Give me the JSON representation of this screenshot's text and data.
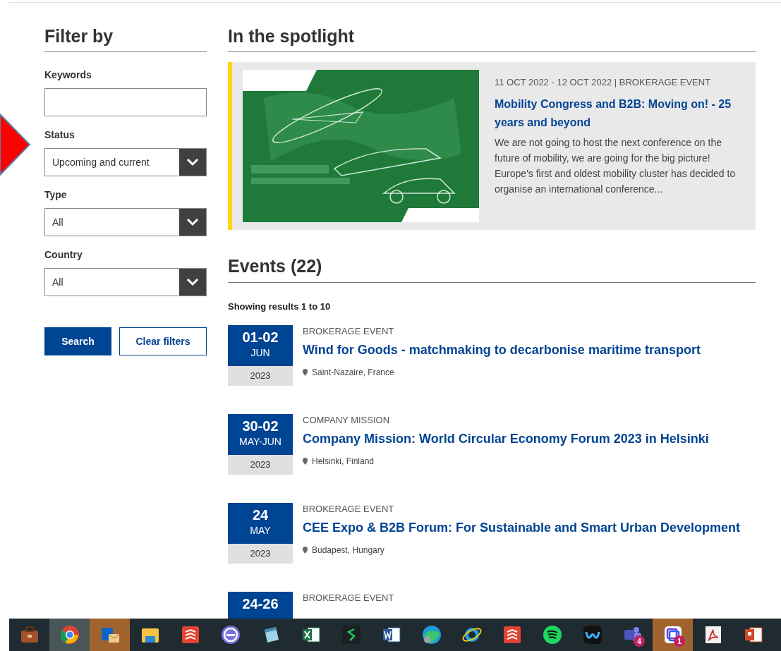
{
  "filters": {
    "title": "Filter by",
    "keywords": {
      "label": "Keywords"
    },
    "selects": [
      {
        "label": "Status",
        "value": "Upcoming and current"
      },
      {
        "label": "Type",
        "value": "All"
      },
      {
        "label": "Country",
        "value": "All"
      }
    ],
    "buttons": [
      {
        "label": "Search",
        "kind": "primary"
      },
      {
        "label": "Clear filters",
        "kind": "secondary"
      }
    ]
  },
  "spotlight": {
    "title": "In the spotlight",
    "meta": "11 OCT 2022 - 12 OCT 2022 | BROKERAGE EVENT",
    "headline": "Mobility Congress and B2B: Moving on! - 25 years and beyond",
    "summary": "We are not going to host the next conference on the future of mobility, we are going for the big picture! Europe's first and oldest mobility cluster has decided to organise an international conference..."
  },
  "events": {
    "title": "Events (22)",
    "results": "Showing results 1 to 10",
    "items": [
      {
        "day": "01-02",
        "month": "JUN",
        "year": "2023",
        "type": "BROKERAGE EVENT",
        "title": "Wind for Goods - matchmaking to decarbonise maritime transport",
        "location": "Saint-Nazaire, France"
      },
      {
        "day": "30-02",
        "month": "MAY-JUN",
        "year": "2023",
        "type": "COMPANY MISSION",
        "title": "Company Mission: World Circular Economy Forum 2023 in Helsinki",
        "location": "Helsinki, Finland"
      },
      {
        "day": "24",
        "month": "MAY",
        "year": "2023",
        "type": "BROKERAGE EVENT",
        "title": "CEE Expo & B2B Forum: For Sustainable and Smart Urban Development",
        "location": "Budapest, Hungary"
      },
      {
        "day": "24-26",
        "type": "BROKERAGE EVENT"
      }
    ]
  },
  "taskbar": {
    "apps": [
      {
        "kind": "briefcase",
        "active": false,
        "flashing": false
      },
      {
        "kind": "chrome",
        "active": true,
        "flashing": false
      },
      {
        "kind": "outlook",
        "active": false,
        "flashing": true
      },
      {
        "kind": "folder",
        "active": false,
        "flashing": false
      },
      {
        "kind": "todo",
        "active": false,
        "flashing": false
      },
      {
        "kind": "ring",
        "active": false,
        "flashing": false
      },
      {
        "kind": "notepad",
        "active": false,
        "flashing": false
      },
      {
        "kind": "excel",
        "active": false,
        "flashing": false
      },
      {
        "kind": "snake",
        "active": false,
        "flashing": false
      },
      {
        "kind": "word",
        "active": false,
        "flashing": false
      },
      {
        "kind": "edge",
        "active": false,
        "flashing": false
      },
      {
        "kind": "ie",
        "active": false,
        "flashing": false
      },
      {
        "kind": "todo",
        "active": false,
        "flashing": false
      },
      {
        "kind": "spotify",
        "active": false,
        "flashing": false
      },
      {
        "kind": "webex",
        "active": false,
        "flashing": false
      },
      {
        "kind": "teams",
        "active": false,
        "flashing": false,
        "badge": "4"
      },
      {
        "kind": "frames",
        "active": false,
        "flashing": true,
        "badge": "1"
      },
      {
        "kind": "acrobat",
        "active": false,
        "flashing": false
      },
      {
        "kind": "powerpoint",
        "active": false,
        "flashing": false
      }
    ]
  }
}
